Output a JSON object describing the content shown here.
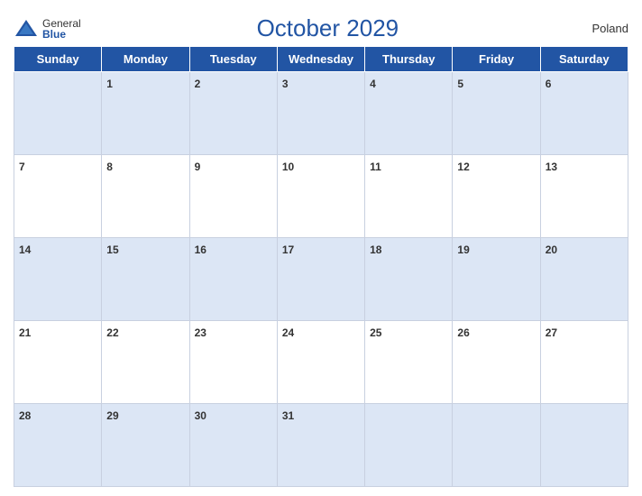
{
  "header": {
    "logo_general": "General",
    "logo_blue": "Blue",
    "title": "October 2029",
    "country": "Poland"
  },
  "days_of_week": [
    "Sunday",
    "Monday",
    "Tuesday",
    "Wednesday",
    "Thursday",
    "Friday",
    "Saturday"
  ],
  "weeks": [
    [
      "",
      "1",
      "2",
      "3",
      "4",
      "5",
      "6"
    ],
    [
      "7",
      "8",
      "9",
      "10",
      "11",
      "12",
      "13"
    ],
    [
      "14",
      "15",
      "16",
      "17",
      "18",
      "19",
      "20"
    ],
    [
      "21",
      "22",
      "23",
      "24",
      "25",
      "26",
      "27"
    ],
    [
      "28",
      "29",
      "30",
      "31",
      "",
      "",
      ""
    ]
  ]
}
